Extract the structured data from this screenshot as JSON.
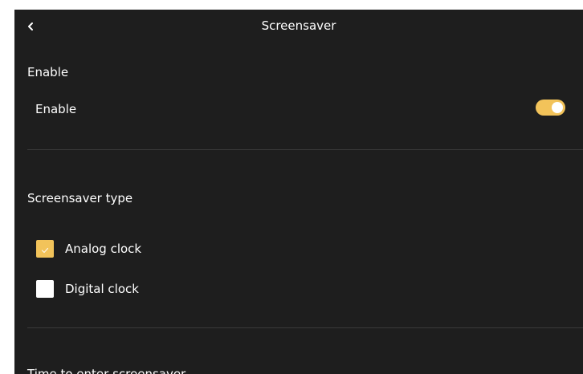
{
  "header": {
    "back_icon": "chevron-left-icon",
    "title": "Screensaver"
  },
  "enable_section": {
    "title": "Enable",
    "row_label": "Enable",
    "toggle_on": true
  },
  "type_section": {
    "title": "Screensaver type",
    "options": [
      {
        "label": "Analog clock",
        "checked": true
      },
      {
        "label": "Digital clock",
        "checked": false
      }
    ]
  },
  "time_section": {
    "title": "Time to enter screensaver"
  },
  "colors": {
    "background": "#1e1e1e",
    "accent": "#f2c35a",
    "divider": "#3a3a3a"
  }
}
